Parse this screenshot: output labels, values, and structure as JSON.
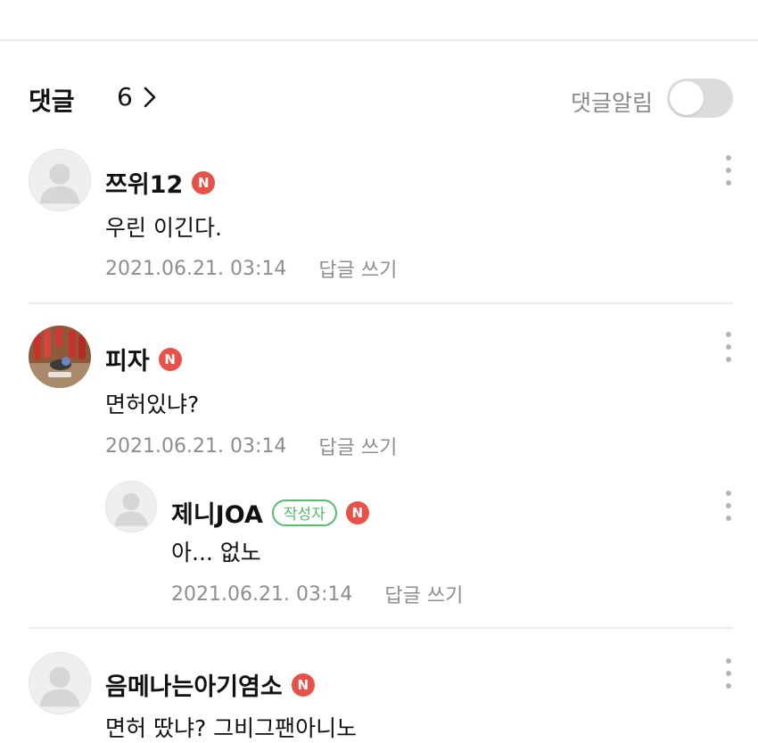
{
  "header": {
    "title": "댓글",
    "count": "6",
    "alarm_label": "댓글알림",
    "alarm_on": false
  },
  "comments": [
    {
      "nickname": "쯔위12",
      "badge": "N",
      "text": "우린 이긴다.",
      "date": "2021.06.21. 03:14",
      "reply_label": "답글 쓰기",
      "avatar": "default"
    },
    {
      "nickname": "피자",
      "badge": "N",
      "text": "면허있냐?",
      "date": "2021.06.21. 03:14",
      "reply_label": "답글 쓰기",
      "avatar": "photo",
      "replies": [
        {
          "nickname": "제니JOA",
          "author_badge": "작성자",
          "badge": "N",
          "text": "아... 없노",
          "date": "2021.06.21. 03:14",
          "reply_label": "답글 쓰기",
          "avatar": "default"
        }
      ]
    },
    {
      "nickname": "음메나는아기염소",
      "badge": "N",
      "text": "면허 땄냐? 그비그팬아니노",
      "avatar": "default"
    }
  ],
  "colors": {
    "n_badge": "#e8504a",
    "author_badge": "#4fbf6b",
    "meta_text": "#8e8e8e",
    "divider": "#ececec"
  }
}
